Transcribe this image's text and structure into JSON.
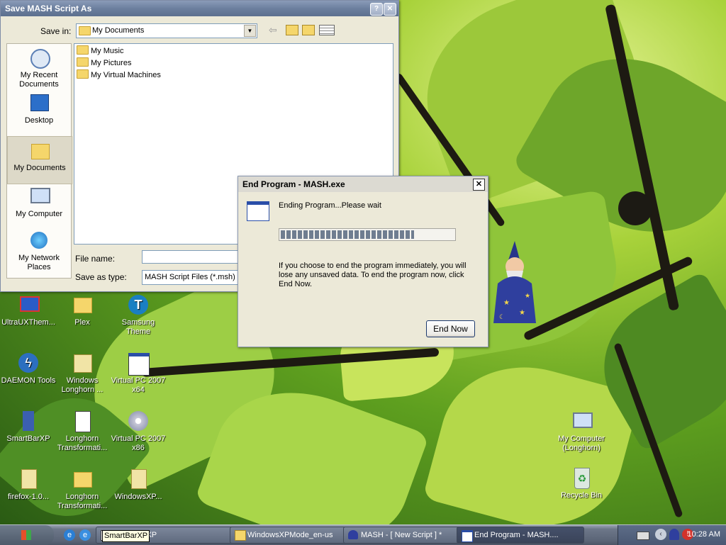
{
  "save_dialog": {
    "title": "Save MASH Script As",
    "save_in_label": "Save in:",
    "save_in_value": "My Documents",
    "places": [
      {
        "label": "My Recent Documents"
      },
      {
        "label": "Desktop"
      },
      {
        "label": "My Documents"
      },
      {
        "label": "My Computer"
      },
      {
        "label": "My Network Places"
      }
    ],
    "files": [
      {
        "name": "My Music"
      },
      {
        "name": "My Pictures"
      },
      {
        "name": "My Virtual Machines"
      }
    ],
    "file_name_label": "File name:",
    "file_name_value": "",
    "save_as_type_label": "Save as type:",
    "save_as_type_value": "MASH Script Files (*.msh)"
  },
  "end_program_dialog": {
    "title": "End Program - MASH.exe",
    "status": "Ending Program...Please wait",
    "progress_fraction": 0.77,
    "message": "If you choose to end the program immediately, you will lose any unsaved data. To end the program now, click End Now.",
    "end_now_button": "End Now",
    "close_glyph": "✕"
  },
  "desktop_icons": [
    {
      "label": "UltraUXThem..."
    },
    {
      "label": "Plex"
    },
    {
      "label": "Samsung Theme"
    },
    {
      "label": "DAEMON Tools"
    },
    {
      "label": "Windows Longhorn ..."
    },
    {
      "label": "Virtual PC 2007 x64"
    },
    {
      "label": "SmartBarXP"
    },
    {
      "label": "Longhorn Transformati..."
    },
    {
      "label": "Virtual PC 2007 x86"
    },
    {
      "label": "firefox-1.0..."
    },
    {
      "label": "Longhorn Transformati..."
    },
    {
      "label": "WindowsXP..."
    },
    {
      "label": "My Computer (Longhorn)"
    },
    {
      "label": "Recycle Bin"
    }
  ],
  "taskbar": {
    "tasks": [
      {
        "label": "SmartBarXP"
      },
      {
        "label": "WindowsXPMode_en-us"
      },
      {
        "label": "MASH - [ New Script ] *"
      },
      {
        "label": "End Program - MASH...."
      }
    ],
    "clock": "10:28 AM"
  },
  "tooltip": "SmartBarXP",
  "colors": {
    "title_bar": "#6c7f9e",
    "progress": "#6f7d90",
    "tooltip_bg": "#ffffe1"
  }
}
